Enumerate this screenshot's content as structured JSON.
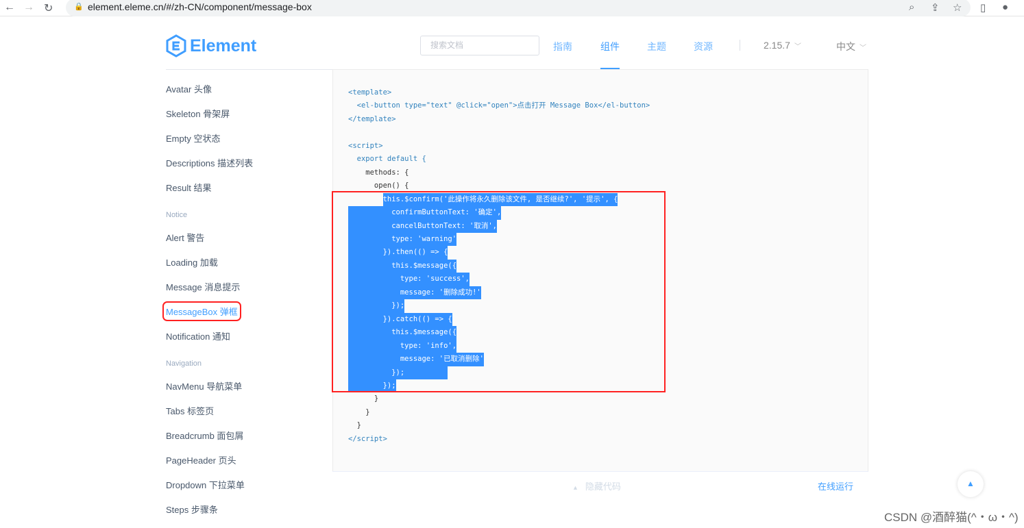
{
  "browser": {
    "url": "element.eleme.cn/#/zh-CN/component/message-box"
  },
  "header": {
    "logo": "Element",
    "search_placeholder": "搜索文档",
    "nav": [
      "指南",
      "组件",
      "主题",
      "资源"
    ],
    "version": "2.15.7",
    "lang": "中文"
  },
  "sidebar": {
    "items": [
      {
        "type": "item",
        "label": "Avatar 头像"
      },
      {
        "type": "item",
        "label": "Skeleton 骨架屏"
      },
      {
        "type": "item",
        "label": "Empty 空状态"
      },
      {
        "type": "item",
        "label": "Descriptions 描述列表"
      },
      {
        "type": "item",
        "label": "Result 结果"
      },
      {
        "type": "group",
        "label": "Notice"
      },
      {
        "type": "item",
        "label": "Alert 警告"
      },
      {
        "type": "item",
        "label": "Loading 加载"
      },
      {
        "type": "item",
        "label": "Message 消息提示"
      },
      {
        "type": "active",
        "label": "MessageBox 弹框"
      },
      {
        "type": "item",
        "label": "Notification 通知"
      },
      {
        "type": "group",
        "label": "Navigation"
      },
      {
        "type": "item",
        "label": "NavMenu 导航菜单"
      },
      {
        "type": "item",
        "label": "Tabs 标签页"
      },
      {
        "type": "item",
        "label": "Breadcrumb 面包屑"
      },
      {
        "type": "item",
        "label": "PageHeader 页头"
      },
      {
        "type": "item",
        "label": "Dropdown 下拉菜单"
      },
      {
        "type": "item",
        "label": "Steps 步骤条"
      }
    ]
  },
  "code": {
    "lines": [
      {
        "t": "<template>",
        "c": "tag"
      },
      {
        "t": "  <el-button type=\"text\" @click=\"open\">点击打开 Message Box</el-button>",
        "c": "tag"
      },
      {
        "t": "</template>",
        "c": "tag"
      },
      {
        "t": ""
      },
      {
        "t": "<script>",
        "c": "tag"
      },
      {
        "t": "  export default {",
        "c": "tag"
      },
      {
        "t": "    methods: {"
      },
      {
        "t": "      open() {"
      },
      {
        "t": "        this.$confirm('此操作将永久删除该文件, 是否继续?', '提示', {",
        "sel": "first"
      },
      {
        "t": "          confirmButtonText: '确定',",
        "sel": "y"
      },
      {
        "t": "          cancelButtonText: '取消',",
        "sel": "y"
      },
      {
        "t": "          type: 'warning'",
        "sel": "y"
      },
      {
        "t": "        }).then(() => {",
        "sel": "y"
      },
      {
        "t": "          this.$message({",
        "sel": "y"
      },
      {
        "t": "            type: 'success',",
        "sel": "y"
      },
      {
        "t": "            message: '删除成功!'",
        "sel": "y"
      },
      {
        "t": "          });",
        "sel": "y"
      },
      {
        "t": "        }).catch(() => {",
        "sel": "y"
      },
      {
        "t": "          this.$message({",
        "sel": "y"
      },
      {
        "t": "            type: 'info',",
        "sel": "y"
      },
      {
        "t": "            message: '已取消删除'",
        "sel": "y"
      },
      {
        "t": "          });          ",
        "sel": "y"
      },
      {
        "t": "        });",
        "sel": "y"
      },
      {
        "t": "      }"
      },
      {
        "t": "    }"
      },
      {
        "t": "  }"
      },
      {
        "t": "</script>",
        "c": "tag"
      }
    ]
  },
  "footer": {
    "hide_code": "隐藏代码",
    "run_online": "在线运行"
  },
  "watermark": "CSDN @酒醉猫(^・ω・^)"
}
